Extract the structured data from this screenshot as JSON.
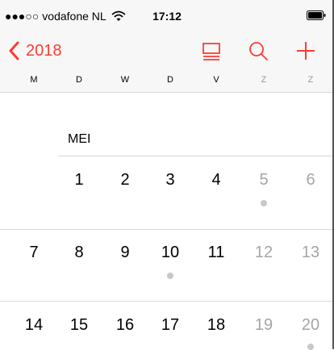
{
  "status": {
    "signal_dots": "●●●○○",
    "carrier": "vodafone NL",
    "time": "17:12"
  },
  "nav": {
    "back_label": "2018",
    "accent_color": "#ff3b30",
    "icons": [
      "list-view-icon",
      "search-icon",
      "add-icon"
    ]
  },
  "weekdays": [
    "M",
    "D",
    "W",
    "D",
    "V",
    "Z",
    "Z"
  ],
  "month_label": "MEI",
  "weeks": [
    {
      "days": [
        "",
        "",
        "",
        "",
        "",
        "",
        ""
      ]
    },
    {
      "days": [
        "1",
        "2",
        "3",
        "4",
        "5",
        "6"
      ],
      "dots": [
        "5"
      ]
    },
    {
      "days": [
        "7",
        "8",
        "9",
        "10",
        "11",
        "12",
        "13"
      ],
      "dots": [
        "10"
      ]
    },
    {
      "days": [
        "14",
        "15",
        "16",
        "17",
        "18",
        "19",
        "20"
      ],
      "dots": [
        "20"
      ]
    }
  ]
}
